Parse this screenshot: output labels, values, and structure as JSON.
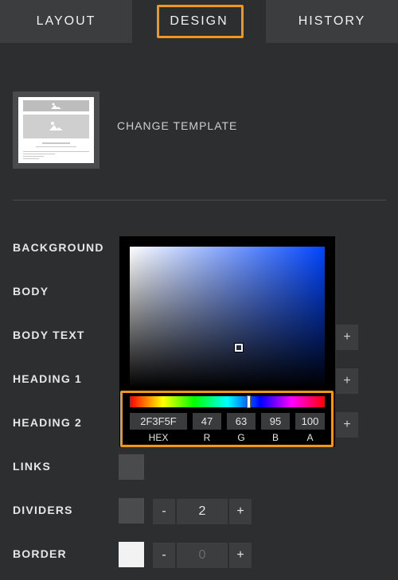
{
  "tabs": [
    {
      "label": "LAYOUT"
    },
    {
      "label": "DESIGN"
    },
    {
      "label": "HISTORY"
    }
  ],
  "active_tab": "DESIGN",
  "template": {
    "change_label": "CHANGE TEMPLATE",
    "thumbnail_icon": "image-icon"
  },
  "rows": {
    "background": "BACKGROUND",
    "body": "BODY",
    "body_text": "BODY TEXT",
    "heading1": "HEADING 1",
    "heading2": "HEADING 2",
    "links": "LINKS",
    "dividers": "DIVIDERS",
    "border": "BORDER"
  },
  "buttons": {
    "plus": "+",
    "minus": "-"
  },
  "dividers_value": "2",
  "border_value": "0",
  "color_picker": {
    "hex": "2F3F5F",
    "r": "47",
    "g": "63",
    "b": "95",
    "a": "100",
    "labels": {
      "hex": "HEX",
      "r": "R",
      "g": "G",
      "b": "B",
      "a": "A"
    }
  },
  "colors": {
    "accent": "#f0961b",
    "panel": "#2d2e30",
    "border_swatch": "#f2f2f2",
    "swatch": "#4a4b4d"
  }
}
